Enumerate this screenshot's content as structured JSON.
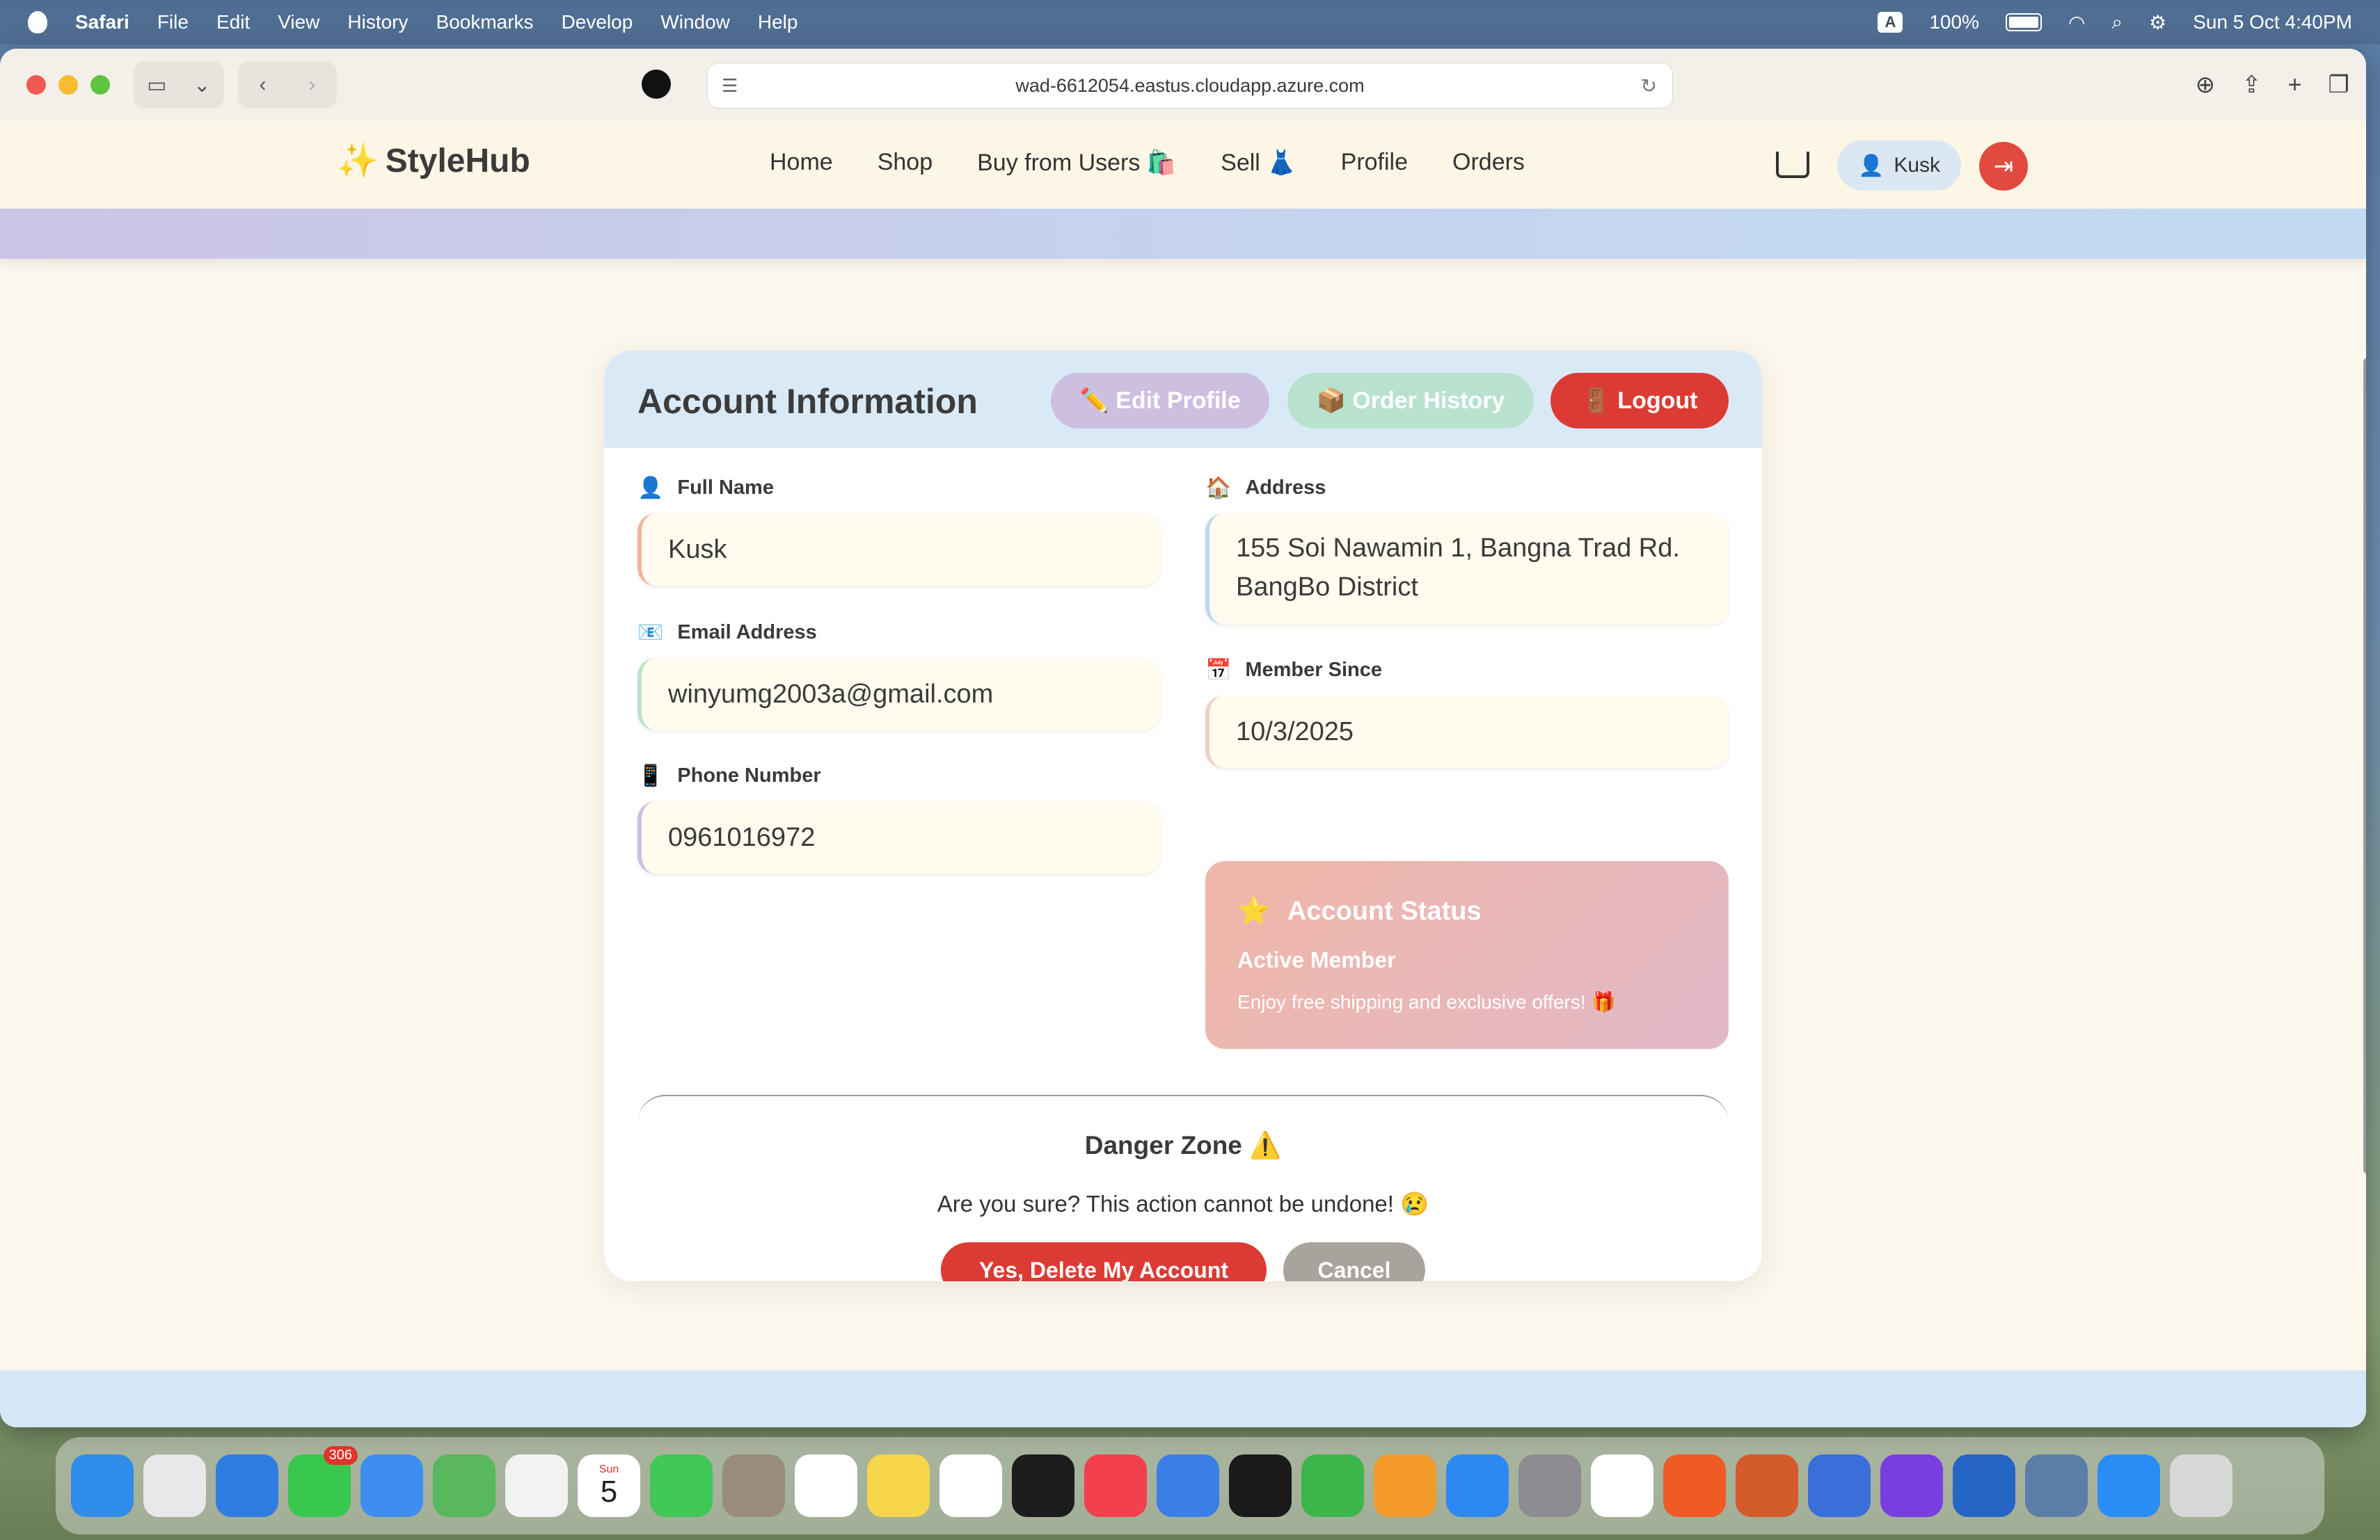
{
  "menubar": {
    "app": "Safari",
    "items": [
      "File",
      "Edit",
      "View",
      "History",
      "Bookmarks",
      "Develop",
      "Window",
      "Help"
    ],
    "input_badge": "A",
    "battery": "100%",
    "datetime": "Sun 5 Oct  4:40PM"
  },
  "browser": {
    "url": "wad-6612054.eastus.cloudapp.azure.com"
  },
  "site": {
    "brand_icon": "✨",
    "brand": "StyleHub",
    "nav": [
      "Home",
      "Shop",
      "Buy from Users 🛍️",
      "Sell 👗",
      "Profile",
      "Orders"
    ],
    "user": "Kusk"
  },
  "account": {
    "title": "Account Information",
    "edit_label": "✏️ Edit Profile",
    "orders_label": "📦 Order History",
    "logout_label": "🚪 Logout",
    "fields": {
      "full_name": {
        "icon": "👤",
        "label": "Full Name",
        "value": "Kusk"
      },
      "email": {
        "icon": "📧",
        "label": "Email Address",
        "value": "winyumg2003a@gmail.com"
      },
      "phone": {
        "icon": "📱",
        "label": "Phone Number",
        "value": "0961016972"
      },
      "address": {
        "icon": "🏠",
        "label": "Address",
        "line1": "155 Soi Nawamin 1, Bangna Trad Rd.",
        "line2": "BangBo District"
      },
      "member_since": {
        "icon": "📅",
        "label": "Member Since",
        "value": "10/3/2025"
      }
    },
    "status": {
      "icon": "⭐",
      "title": "Account Status",
      "sub": "Active Member",
      "note": "Enjoy free shipping and exclusive offers! 🎁"
    },
    "danger": {
      "title": "Danger Zone ⚠️",
      "text": "Are you sure? This action cannot be undone! 😢",
      "delete_label": "Yes, Delete My Account",
      "cancel_label": "Cancel"
    }
  },
  "dock": {
    "messages_badge": "306",
    "calendar_day": "5",
    "calendar_month": "Sun",
    "apps": [
      "Finder",
      "Launchpad",
      "Safari",
      "Messages",
      "Mail",
      "Maps",
      "Photos",
      "Calendar",
      "FaceTime",
      "Contacts",
      "Reminders",
      "Notes",
      "Freeform",
      "TV",
      "Music",
      "Keynote",
      "Terminal",
      "Numbers",
      "Pages",
      "App Store",
      "System Settings",
      "Chrome",
      "Brave",
      "Dictionary",
      "Simulator",
      "Feedback",
      "VS Code",
      "Database",
      "Messenger",
      "Trash"
    ],
    "colors": [
      "#2f8ce8",
      "#e8e8ea",
      "#2f7de0",
      "#37c84d",
      "#3d8ef0",
      "#57b85e",
      "#f2f2f2",
      "#ffffff",
      "#3fc757",
      "#9a8c7a",
      "#ffffff",
      "#f7d54a",
      "#ffffff",
      "#1c1c1c",
      "#f2404c",
      "#3b7ee8",
      "#1a1a1a",
      "#3cb64a",
      "#f39a2b",
      "#2d89f0",
      "#8c8c90",
      "#ffffff",
      "#f05a24",
      "#d35a2a",
      "#3a6ed8",
      "#7a3ee0",
      "#2466c4",
      "#5a7ea8",
      "#2a8cf5",
      "#d8d8d8"
    ]
  }
}
